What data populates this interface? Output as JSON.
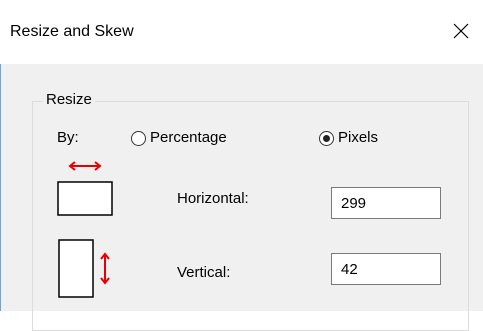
{
  "dialog": {
    "title": "Resize and Skew",
    "close_icon": "close-icon"
  },
  "resize": {
    "group_label": "Resize",
    "by_label": "By:",
    "options": [
      {
        "label": "Percentage",
        "selected": false
      },
      {
        "label": "Pixels",
        "selected": true
      }
    ],
    "horizontal": {
      "label": "Horizontal:",
      "value": "299",
      "icon": "horizontal-resize-icon"
    },
    "vertical": {
      "label": "Vertical:",
      "value": "42",
      "icon": "vertical-resize-icon"
    }
  },
  "colors": {
    "arrow": "#e60000",
    "window_border": "#6aa4d8"
  }
}
